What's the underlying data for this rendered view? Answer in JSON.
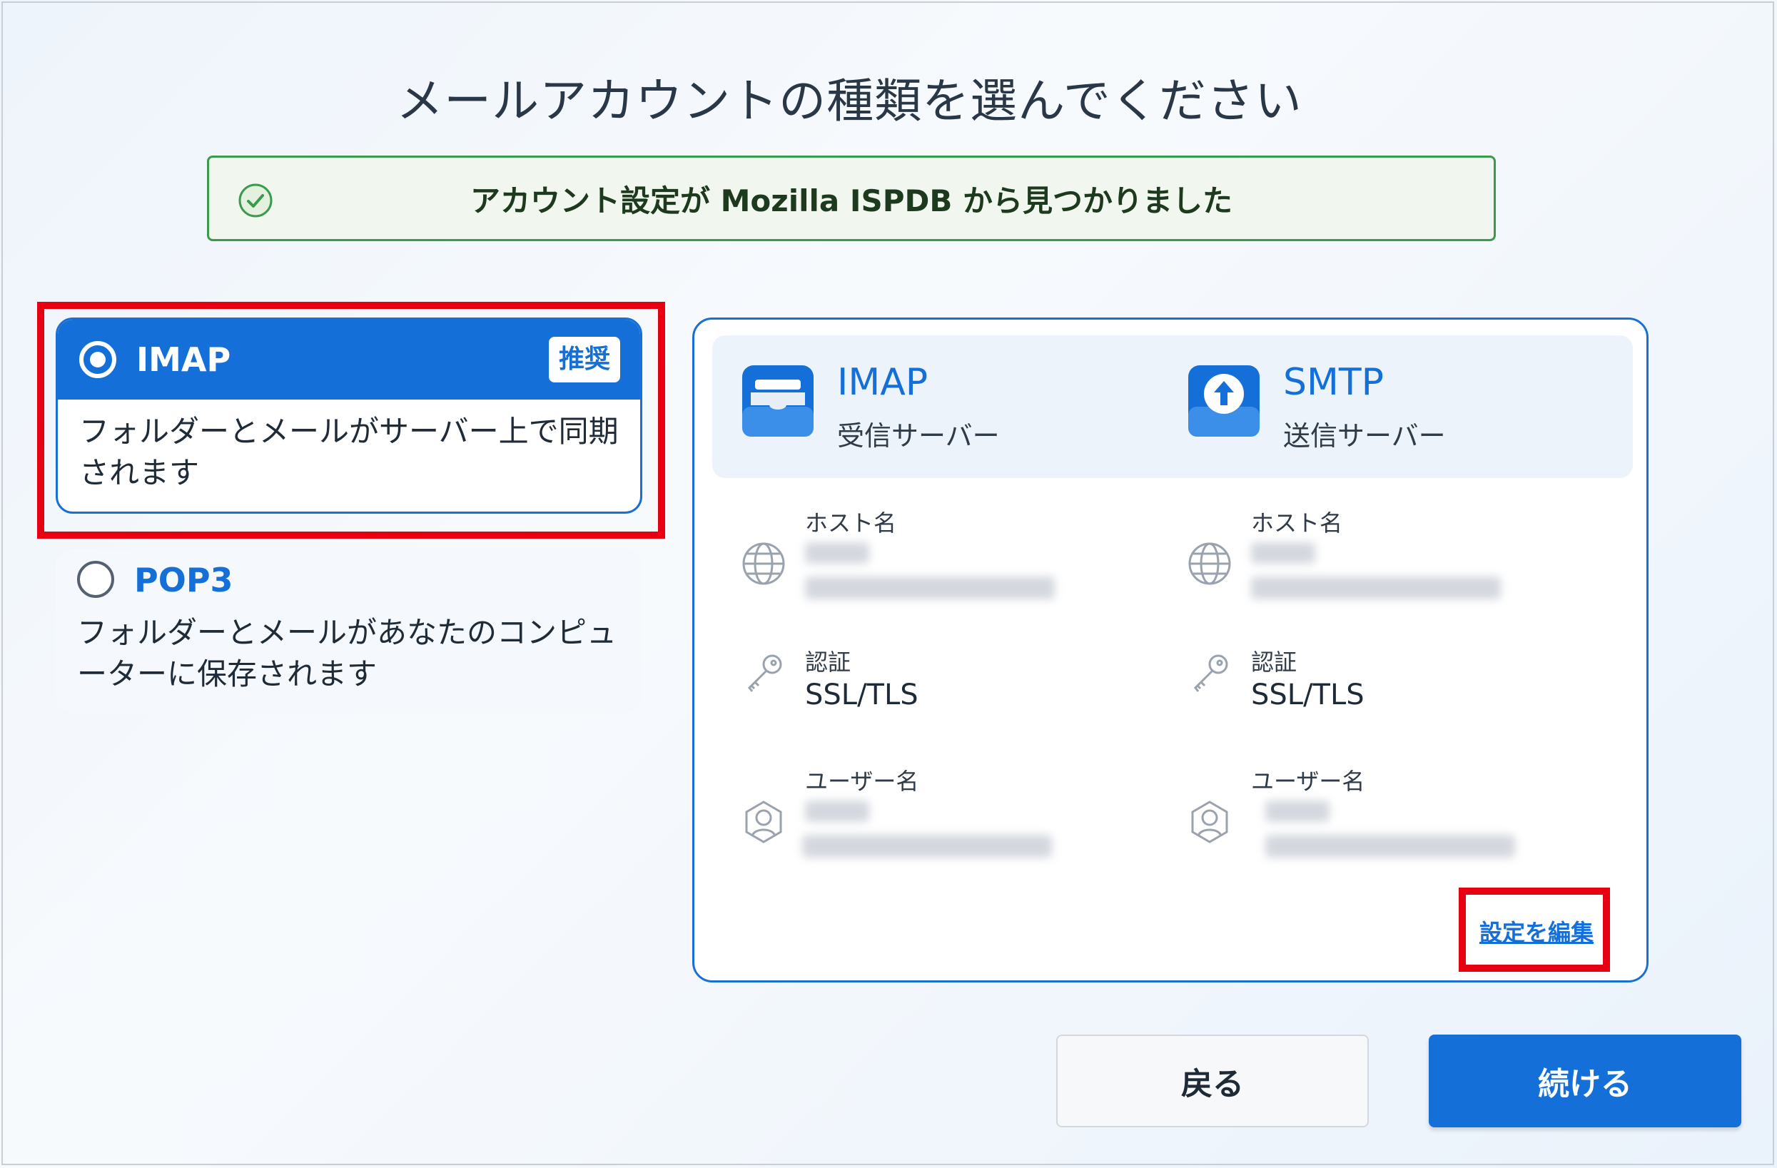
{
  "title": "メールアカウントの種類を選んでください",
  "notice": {
    "text": "アカウント設定が Mozilla ISPDB から見つかりました"
  },
  "options": {
    "imap": {
      "name": "IMAP",
      "badge": "推奨",
      "description": "フォルダーとメールがサーバー上で同期されます",
      "selected": true
    },
    "pop3": {
      "name": "POP3",
      "description": "フォルダーとメールがあなたのコンピューターに保存されます",
      "selected": false
    }
  },
  "details": {
    "incoming": {
      "protocol": "IMAP",
      "role": "受信サーバー",
      "hostname_label": "ホスト名",
      "auth_label": "認証",
      "auth_value": "SSL/TLS",
      "username_label": "ユーザー名"
    },
    "outgoing": {
      "protocol": "SMTP",
      "role": "送信サーバー",
      "hostname_label": "ホスト名",
      "auth_label": "認証",
      "auth_value": "SSL/TLS",
      "username_label": "ユーザー名"
    },
    "edit_link": "設定を編集"
  },
  "buttons": {
    "back": "戻る",
    "continue": "続ける"
  },
  "colors": {
    "accent": "#1470d8",
    "success": "#3b9a4e",
    "highlight": "#e60012"
  }
}
